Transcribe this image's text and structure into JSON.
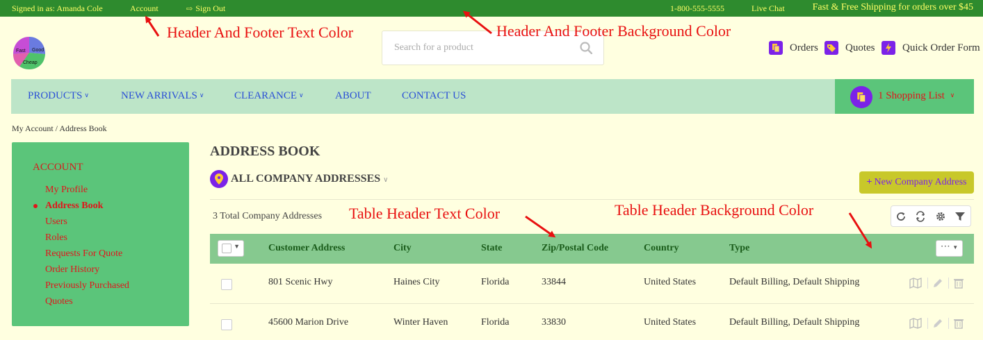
{
  "topbar": {
    "signed_in": "Signed in as: Amanda Cole",
    "account": "Account",
    "sign_out": "Sign Out",
    "phone": "1-800-555-5555",
    "live_chat": "Live Chat",
    "shipping": "Fast & Free Shipping for orders over $45"
  },
  "logo": {
    "fast": "Fast",
    "good": "Good",
    "cheap": "Cheap"
  },
  "search": {
    "placeholder": "Search for a product"
  },
  "header_links": {
    "orders": "Orders",
    "quotes": "Quotes",
    "quick_order": "Quick Order Form"
  },
  "nav": {
    "items": [
      "PRODUCTS",
      "NEW ARRIVALS",
      "CLEARANCE",
      "ABOUT",
      "CONTACT US"
    ],
    "shopping_list": "1 Shopping List"
  },
  "breadcrumb": "My Account / Address Book",
  "sidebar": {
    "heading": "ACCOUNT",
    "items": [
      "My Profile",
      "Address Book",
      "Users",
      "Roles",
      "Requests For Quote",
      "Order History",
      "Previously Purchased",
      "Quotes"
    ],
    "active": "Address Book"
  },
  "page": {
    "title": "ADDRESS BOOK",
    "filter_label": "ALL COMPANY ADDRESSES",
    "new_button": "New Company Address",
    "total": "3 Total Company Addresses"
  },
  "table": {
    "columns": [
      "Customer Address",
      "City",
      "State",
      "Zip/Postal Code",
      "Country",
      "Type"
    ],
    "rows": [
      [
        "801 Scenic Hwy",
        "Haines City",
        "Florida",
        "33844",
        "United States",
        "Default Billing, Default Shipping"
      ],
      [
        "45600 Marion Drive",
        "Winter Haven",
        "Florida",
        "33830",
        "United States",
        "Default Billing, Default Shipping"
      ]
    ]
  },
  "annotations": {
    "header_footer_text": "Header And Footer Text Color",
    "header_footer_bg": "Header And Footer Background Color",
    "table_header_text": "Table Header Text Color",
    "table_header_bg": "Table Header Background Color"
  },
  "colors": {
    "header_footer_bg": "#2e8b2e",
    "header_footer_text": "#ffff66",
    "page_bg": "#ffffe0",
    "nav_bg": "#bde5c8",
    "sidebar_bg": "#5bc57a",
    "table_header_bg": "#86c98f",
    "table_header_text": "#1a5c1a",
    "accent_purple": "#7b22e8",
    "link_red": "#e0161b",
    "annotation_red": "#e81010"
  }
}
